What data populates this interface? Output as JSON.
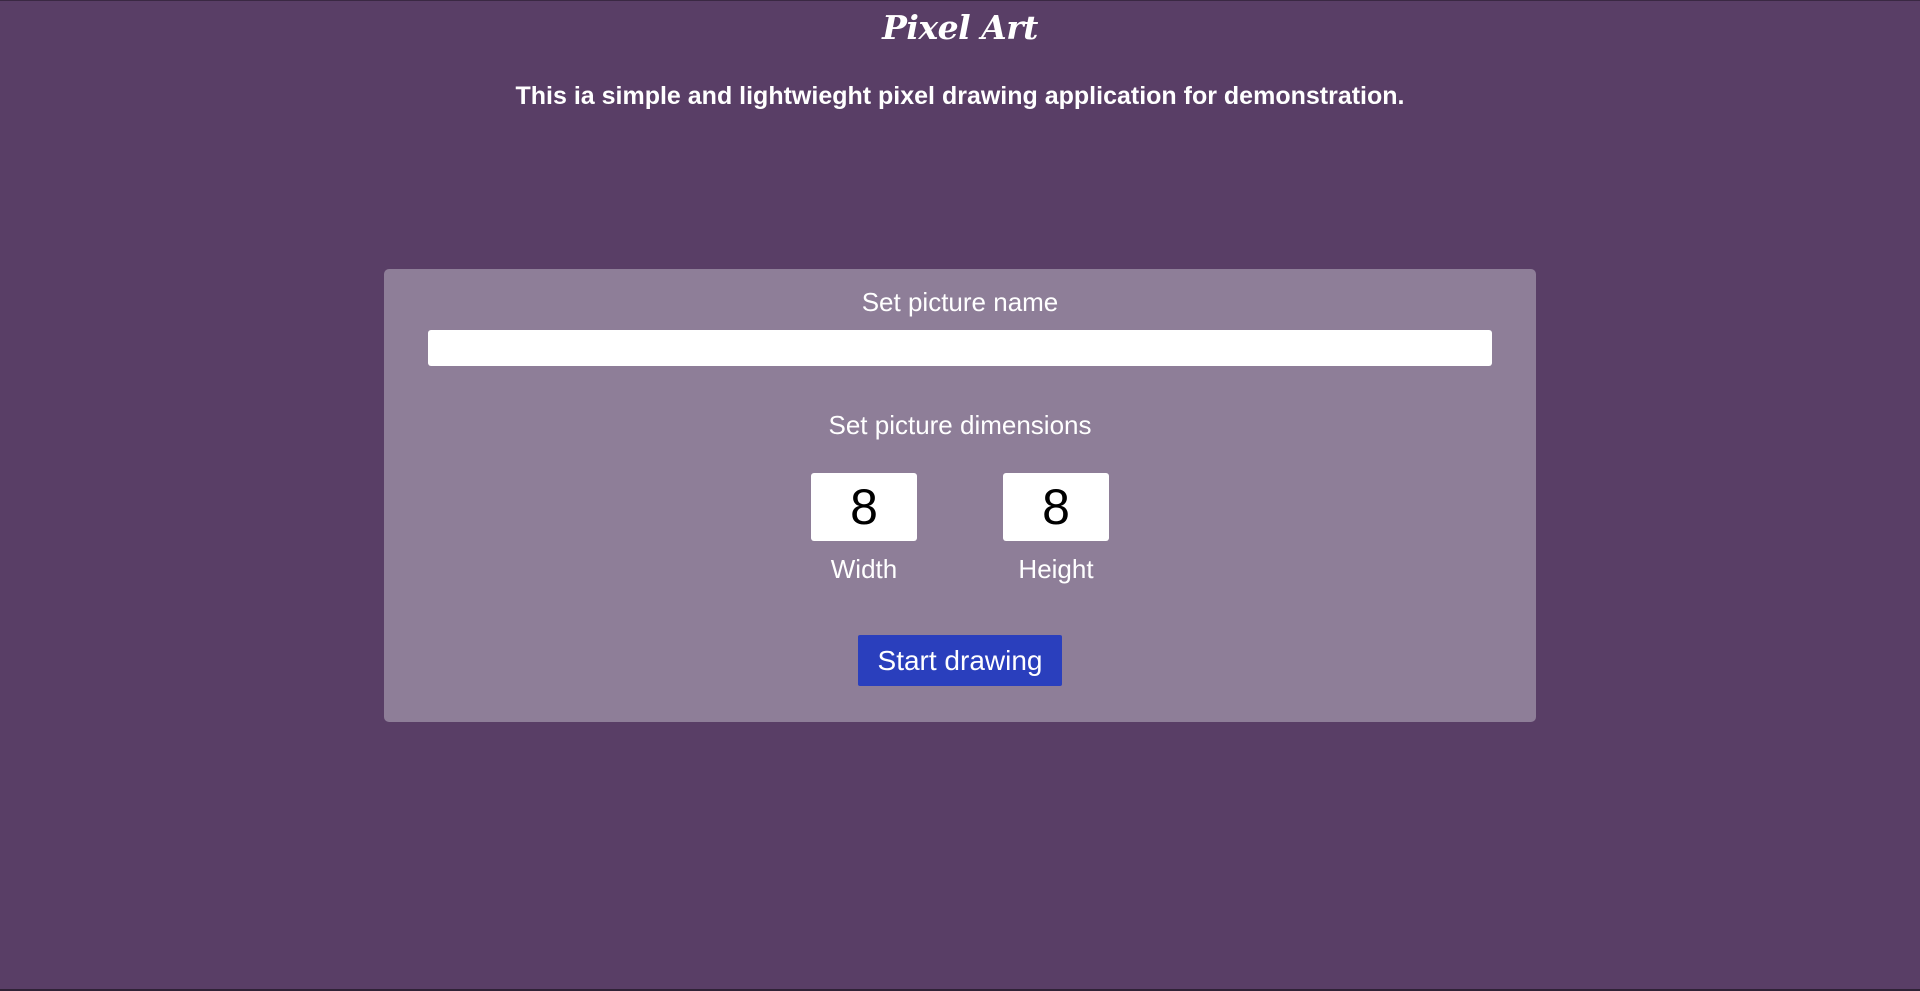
{
  "header": {
    "title": "Pixel Art",
    "subtitle": "This ia simple and lightwieght pixel drawing application for demonstration."
  },
  "setup": {
    "name_label": "Set picture name",
    "name_value": "",
    "name_placeholder": "",
    "dimensions_label": "Set picture dimensions",
    "width_value": "8",
    "width_label": "Width",
    "height_value": "8",
    "height_label": "Height",
    "start_button_label": "Start drawing"
  },
  "colors": {
    "background": "#593e66",
    "panel": "#8e7e98",
    "button": "#2a3fbd",
    "text": "#ffffff"
  }
}
